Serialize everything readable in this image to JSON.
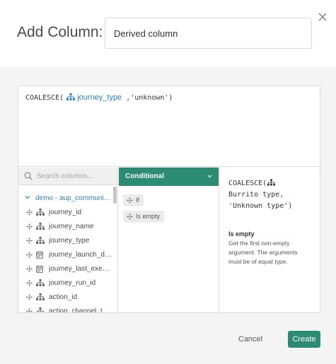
{
  "header": {
    "title": "Add Column:",
    "column_name_value": "Derived column"
  },
  "expression": {
    "func_open": "COALESCE(",
    "field": "journey_type",
    "rest": ",'unknown')"
  },
  "column_list": {
    "search_placeholder": "Search columns...",
    "group_label": "demo - aup_communi…",
    "items": [
      {
        "label": "journey_id",
        "icon": "tree-icon"
      },
      {
        "label": "journey_name",
        "icon": "tree-icon"
      },
      {
        "label": "journey_type",
        "icon": "tree-icon"
      },
      {
        "label": "journey_launch_date",
        "icon": "calendar-icon"
      },
      {
        "label": "journey_last_execu…",
        "icon": "calendar-icon"
      },
      {
        "label": "journey_run_id",
        "icon": "tree-icon"
      },
      {
        "label": "action_id",
        "icon": "tree-icon"
      },
      {
        "label": "action_channel_type",
        "icon": "tree-icon"
      }
    ]
  },
  "functions": {
    "category": "Conditional",
    "items": [
      "If",
      "Is empty"
    ]
  },
  "doc": {
    "sig_line1": "COALESCE(",
    "sig_line2": "Burrito type,",
    "sig_line3": "'Unknown type')",
    "name": "Is empty",
    "description": "Get the first non-empty argument. The arguments must be of equal type."
  },
  "footer": {
    "cancel_label": "Cancel",
    "create_label": "Create"
  },
  "colors": {
    "accent": "#2b8c73",
    "link": "#2a7fc1"
  }
}
